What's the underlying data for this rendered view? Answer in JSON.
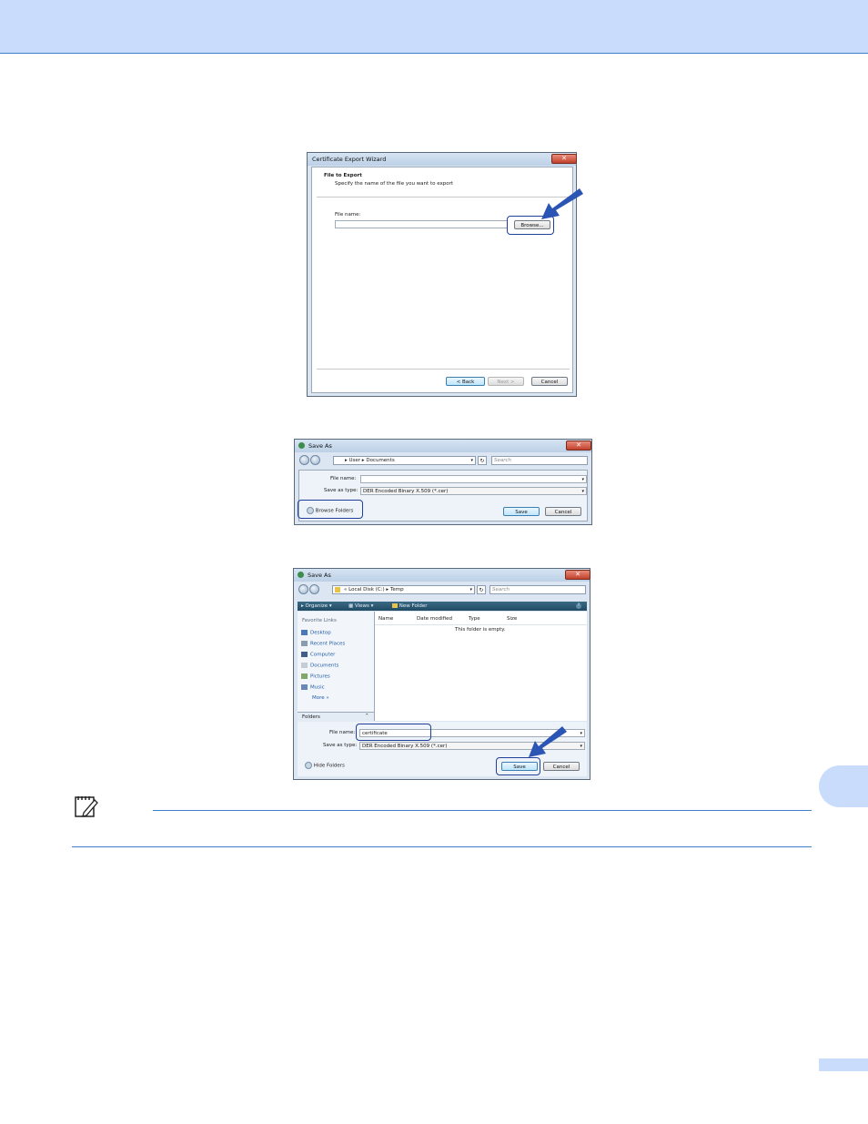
{
  "wizard": {
    "title": "Certificate Export Wizard",
    "close_glyph": "✕",
    "heading": "File to Export",
    "subheading": "Specify the name of the file you want to export",
    "file_name_label": "File name:",
    "file_name_value": "",
    "browse_label": "Browse...",
    "back_label": "< Back",
    "next_label": "Next >",
    "cancel_label": "Cancel"
  },
  "save_as_collapsed": {
    "title": "Save As",
    "close_glyph": "✕",
    "breadcrumb": [
      "User",
      "Documents"
    ],
    "search_placeholder": "Search",
    "file_name_label": "File name:",
    "file_name_value": "",
    "save_as_type_label": "Save as type:",
    "save_as_type_value": "DER Encoded Binary X.509 (*.cer)",
    "browse_folders_label": "Browse Folders",
    "save_label": "Save",
    "cancel_label": "Cancel"
  },
  "save_as_expanded": {
    "title": "Save As",
    "close_glyph": "✕",
    "breadcrumb_prefix": "«",
    "breadcrumb": [
      "Local Disk (C:)",
      "Temp"
    ],
    "search_placeholder": "Search",
    "toolbar": {
      "organize": "Organize",
      "views": "Views",
      "new_folder": "New Folder",
      "help": "?"
    },
    "favorite_links_label": "Favorite Links",
    "favorite_links": [
      "Desktop",
      "Recent Places",
      "Computer",
      "Documents",
      "Pictures",
      "Music",
      "More"
    ],
    "more_glyph": "»",
    "folders_label": "Folders",
    "columns": [
      "Name",
      "Date modified",
      "Type",
      "Size"
    ],
    "empty_message": "This folder is empty.",
    "file_name_label": "File name:",
    "file_name_value": "certificate",
    "save_as_type_label": "Save as type:",
    "save_as_type_value": "DER Encoded Binary X.509 (*.cer)",
    "hide_folders_label": "Hide Folders",
    "save_label": "Save",
    "cancel_label": "Cancel"
  },
  "colors": {
    "header_band": "#c9dcfb",
    "rule": "#3f7fd0",
    "highlight": "#1f3f9a",
    "arrow": "#2b55b5"
  },
  "icons": [
    "note-pencil-icon",
    "arrow-pointer-icon",
    "close-icon",
    "back-icon",
    "forward-icon",
    "refresh-icon",
    "search-icon",
    "folder-icon",
    "dropdown-icon"
  ]
}
